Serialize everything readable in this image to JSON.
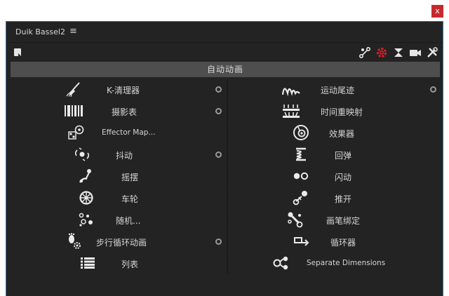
{
  "window": {
    "close_label": "x"
  },
  "panel": {
    "tab_title": "Duik Bassel2",
    "menu_icon": "≡"
  },
  "toolbar": {
    "icons": [
      "note-icon",
      "bone-link-icon",
      "gear-red-icon",
      "hourglass-icon",
      "camera-icon",
      "tools-icon"
    ],
    "accent": "#e0202a"
  },
  "section": {
    "title": "自动动画"
  },
  "left_items": [
    {
      "label": "K-清理器",
      "icon": "broom-icon",
      "has_option": true
    },
    {
      "label": "摄影表",
      "icon": "barcode-icon",
      "has_option": true
    },
    {
      "label": "Effector Map...",
      "icon": "effector-map-icon",
      "has_option": false
    },
    {
      "label": "抖动",
      "icon": "wiggle-icon",
      "has_option": true
    },
    {
      "label": "摇摆",
      "icon": "swing-icon",
      "has_option": false
    },
    {
      "label": "车轮",
      "icon": "wheel-icon",
      "has_option": false
    },
    {
      "label": "随机...",
      "icon": "random-icon",
      "has_option": false
    },
    {
      "label": "步行循环动画",
      "icon": "walk-cycle-icon",
      "has_option": true
    },
    {
      "label": "列表",
      "icon": "list-icon",
      "has_option": false
    }
  ],
  "right_items": [
    {
      "label": "运动尾迹",
      "icon": "motion-trail-icon",
      "has_option": true
    },
    {
      "label": "时间重映射",
      "icon": "time-remap-icon",
      "has_option": false
    },
    {
      "label": "效果器",
      "icon": "effector-icon",
      "has_option": false
    },
    {
      "label": "回弹",
      "icon": "spring-icon",
      "has_option": false
    },
    {
      "label": "闪动",
      "icon": "blink-icon",
      "has_option": false
    },
    {
      "label": "推开",
      "icon": "move-away-icon",
      "has_option": false
    },
    {
      "label": "画笔绑定",
      "icon": "paint-rig-icon",
      "has_option": false
    },
    {
      "label": "循环器",
      "icon": "looper-icon",
      "has_option": false
    },
    {
      "label": "Separate Dimensions",
      "icon": "separate-dimensions-icon",
      "has_option": false
    }
  ]
}
